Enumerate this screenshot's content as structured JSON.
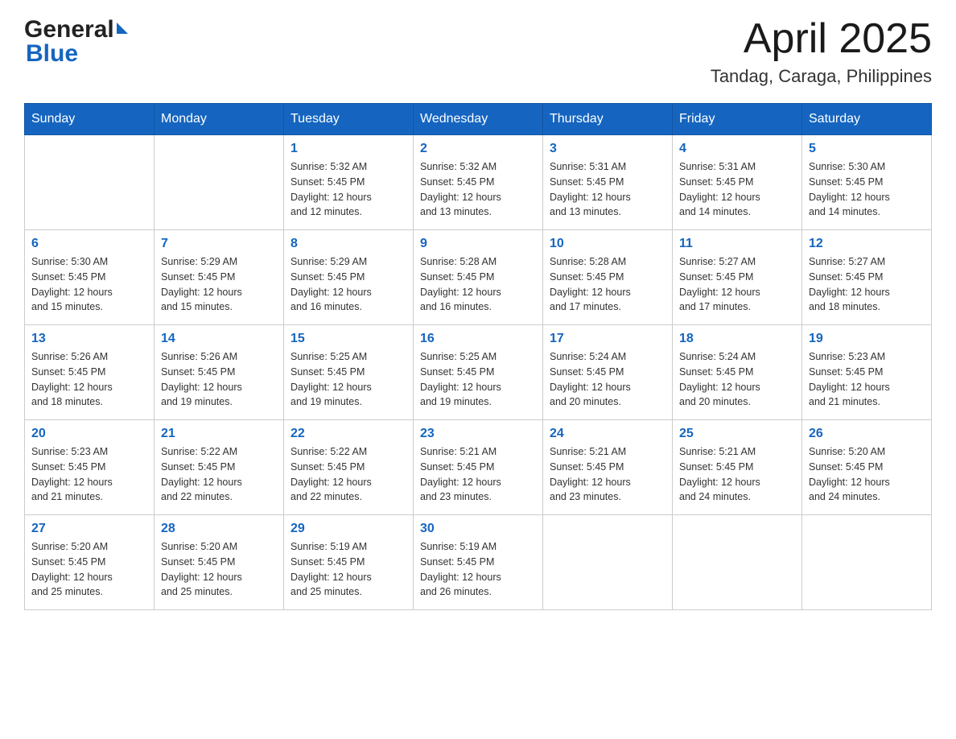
{
  "header": {
    "logo_general": "General",
    "logo_blue": "Blue",
    "month_year": "April 2025",
    "location": "Tandag, Caraga, Philippines"
  },
  "weekdays": [
    "Sunday",
    "Monday",
    "Tuesday",
    "Wednesday",
    "Thursday",
    "Friday",
    "Saturday"
  ],
  "weeks": [
    [
      {
        "day": "",
        "info": ""
      },
      {
        "day": "",
        "info": ""
      },
      {
        "day": "1",
        "info": "Sunrise: 5:32 AM\nSunset: 5:45 PM\nDaylight: 12 hours\nand 12 minutes."
      },
      {
        "day": "2",
        "info": "Sunrise: 5:32 AM\nSunset: 5:45 PM\nDaylight: 12 hours\nand 13 minutes."
      },
      {
        "day": "3",
        "info": "Sunrise: 5:31 AM\nSunset: 5:45 PM\nDaylight: 12 hours\nand 13 minutes."
      },
      {
        "day": "4",
        "info": "Sunrise: 5:31 AM\nSunset: 5:45 PM\nDaylight: 12 hours\nand 14 minutes."
      },
      {
        "day": "5",
        "info": "Sunrise: 5:30 AM\nSunset: 5:45 PM\nDaylight: 12 hours\nand 14 minutes."
      }
    ],
    [
      {
        "day": "6",
        "info": "Sunrise: 5:30 AM\nSunset: 5:45 PM\nDaylight: 12 hours\nand 15 minutes."
      },
      {
        "day": "7",
        "info": "Sunrise: 5:29 AM\nSunset: 5:45 PM\nDaylight: 12 hours\nand 15 minutes."
      },
      {
        "day": "8",
        "info": "Sunrise: 5:29 AM\nSunset: 5:45 PM\nDaylight: 12 hours\nand 16 minutes."
      },
      {
        "day": "9",
        "info": "Sunrise: 5:28 AM\nSunset: 5:45 PM\nDaylight: 12 hours\nand 16 minutes."
      },
      {
        "day": "10",
        "info": "Sunrise: 5:28 AM\nSunset: 5:45 PM\nDaylight: 12 hours\nand 17 minutes."
      },
      {
        "day": "11",
        "info": "Sunrise: 5:27 AM\nSunset: 5:45 PM\nDaylight: 12 hours\nand 17 minutes."
      },
      {
        "day": "12",
        "info": "Sunrise: 5:27 AM\nSunset: 5:45 PM\nDaylight: 12 hours\nand 18 minutes."
      }
    ],
    [
      {
        "day": "13",
        "info": "Sunrise: 5:26 AM\nSunset: 5:45 PM\nDaylight: 12 hours\nand 18 minutes."
      },
      {
        "day": "14",
        "info": "Sunrise: 5:26 AM\nSunset: 5:45 PM\nDaylight: 12 hours\nand 19 minutes."
      },
      {
        "day": "15",
        "info": "Sunrise: 5:25 AM\nSunset: 5:45 PM\nDaylight: 12 hours\nand 19 minutes."
      },
      {
        "day": "16",
        "info": "Sunrise: 5:25 AM\nSunset: 5:45 PM\nDaylight: 12 hours\nand 19 minutes."
      },
      {
        "day": "17",
        "info": "Sunrise: 5:24 AM\nSunset: 5:45 PM\nDaylight: 12 hours\nand 20 minutes."
      },
      {
        "day": "18",
        "info": "Sunrise: 5:24 AM\nSunset: 5:45 PM\nDaylight: 12 hours\nand 20 minutes."
      },
      {
        "day": "19",
        "info": "Sunrise: 5:23 AM\nSunset: 5:45 PM\nDaylight: 12 hours\nand 21 minutes."
      }
    ],
    [
      {
        "day": "20",
        "info": "Sunrise: 5:23 AM\nSunset: 5:45 PM\nDaylight: 12 hours\nand 21 minutes."
      },
      {
        "day": "21",
        "info": "Sunrise: 5:22 AM\nSunset: 5:45 PM\nDaylight: 12 hours\nand 22 minutes."
      },
      {
        "day": "22",
        "info": "Sunrise: 5:22 AM\nSunset: 5:45 PM\nDaylight: 12 hours\nand 22 minutes."
      },
      {
        "day": "23",
        "info": "Sunrise: 5:21 AM\nSunset: 5:45 PM\nDaylight: 12 hours\nand 23 minutes."
      },
      {
        "day": "24",
        "info": "Sunrise: 5:21 AM\nSunset: 5:45 PM\nDaylight: 12 hours\nand 23 minutes."
      },
      {
        "day": "25",
        "info": "Sunrise: 5:21 AM\nSunset: 5:45 PM\nDaylight: 12 hours\nand 24 minutes."
      },
      {
        "day": "26",
        "info": "Sunrise: 5:20 AM\nSunset: 5:45 PM\nDaylight: 12 hours\nand 24 minutes."
      }
    ],
    [
      {
        "day": "27",
        "info": "Sunrise: 5:20 AM\nSunset: 5:45 PM\nDaylight: 12 hours\nand 25 minutes."
      },
      {
        "day": "28",
        "info": "Sunrise: 5:20 AM\nSunset: 5:45 PM\nDaylight: 12 hours\nand 25 minutes."
      },
      {
        "day": "29",
        "info": "Sunrise: 5:19 AM\nSunset: 5:45 PM\nDaylight: 12 hours\nand 25 minutes."
      },
      {
        "day": "30",
        "info": "Sunrise: 5:19 AM\nSunset: 5:45 PM\nDaylight: 12 hours\nand 26 minutes."
      },
      {
        "day": "",
        "info": ""
      },
      {
        "day": "",
        "info": ""
      },
      {
        "day": "",
        "info": ""
      }
    ]
  ]
}
